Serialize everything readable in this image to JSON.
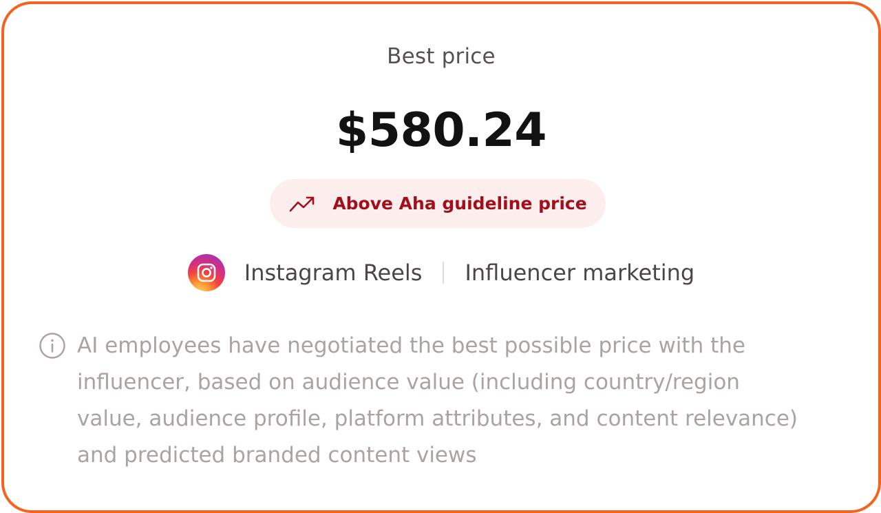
{
  "card": {
    "title": "Best price",
    "price": "$580.24",
    "badge": {
      "label": "Above Aha guideline price",
      "icon": "trending-up-icon",
      "text_color": "#a0101c",
      "background": "#fdeeee"
    },
    "platform": {
      "name": "Instagram Reels",
      "icon": "instagram-icon"
    },
    "category": "Influencer marketing",
    "info": {
      "icon": "info-icon",
      "text": "AI employees have negotiated the best possible price with the influencer, based on audience value (including country/region value, audience profile, platform attributes, and content relevance) and predicted branded content views"
    },
    "border_color": "#f2641f"
  }
}
